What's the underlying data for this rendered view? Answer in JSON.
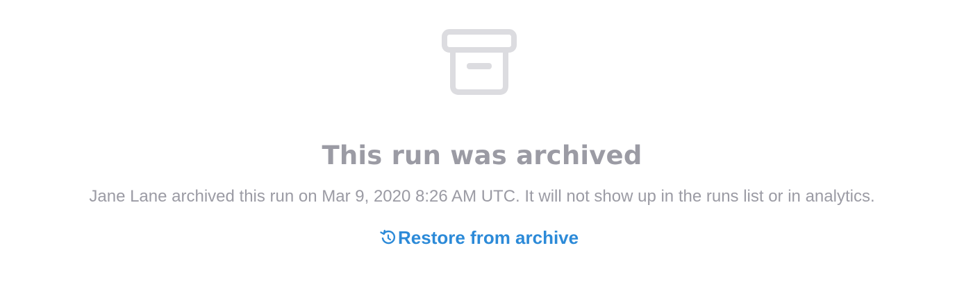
{
  "archived_notice": {
    "icon": "archive-box-icon",
    "title": "This run was archived",
    "message": "Jane Lane archived this run on Mar 9, 2020 8:26 AM UTC. It will not show up in the runs list or in analytics.",
    "restore_action": {
      "icon": "restore-history-icon",
      "label": "Restore from archive",
      "color": "#2c8ad8"
    },
    "muted_color": "#9b9ba4",
    "icon_color": "#dcdce0"
  }
}
